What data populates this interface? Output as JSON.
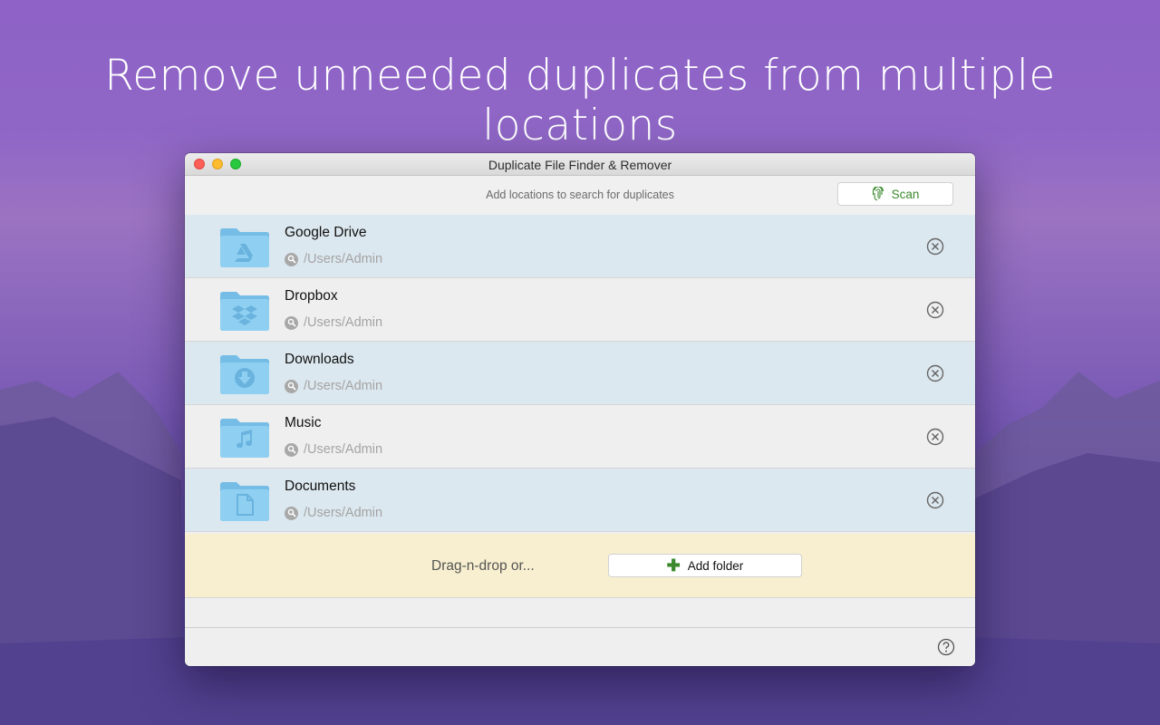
{
  "headline": "Remove unneeded duplicates from multiple locations",
  "window": {
    "title": "Duplicate File Finder & Remover"
  },
  "toolbar": {
    "hint": "Add locations to search for duplicates",
    "scan_label": "Scan"
  },
  "locations": [
    {
      "name": "Google Drive",
      "path": "/Users/Admin",
      "icon": "google-drive-folder-icon"
    },
    {
      "name": "Dropbox",
      "path": "/Users/Admin",
      "icon": "dropbox-folder-icon"
    },
    {
      "name": "Downloads",
      "path": "/Users/Admin",
      "icon": "downloads-folder-icon"
    },
    {
      "name": "Music",
      "path": "/Users/Admin",
      "icon": "music-folder-icon"
    },
    {
      "name": "Documents",
      "path": "/Users/Admin",
      "icon": "documents-folder-icon"
    }
  ],
  "dropzone": {
    "text": "Drag-n-drop or...",
    "add_label": "Add folder"
  },
  "colors": {
    "accent_green": "#3a8a2d",
    "row_alt": "#dce8ef",
    "dropzone": "#f7efcf",
    "folder_blue": "#8fd0f2"
  }
}
